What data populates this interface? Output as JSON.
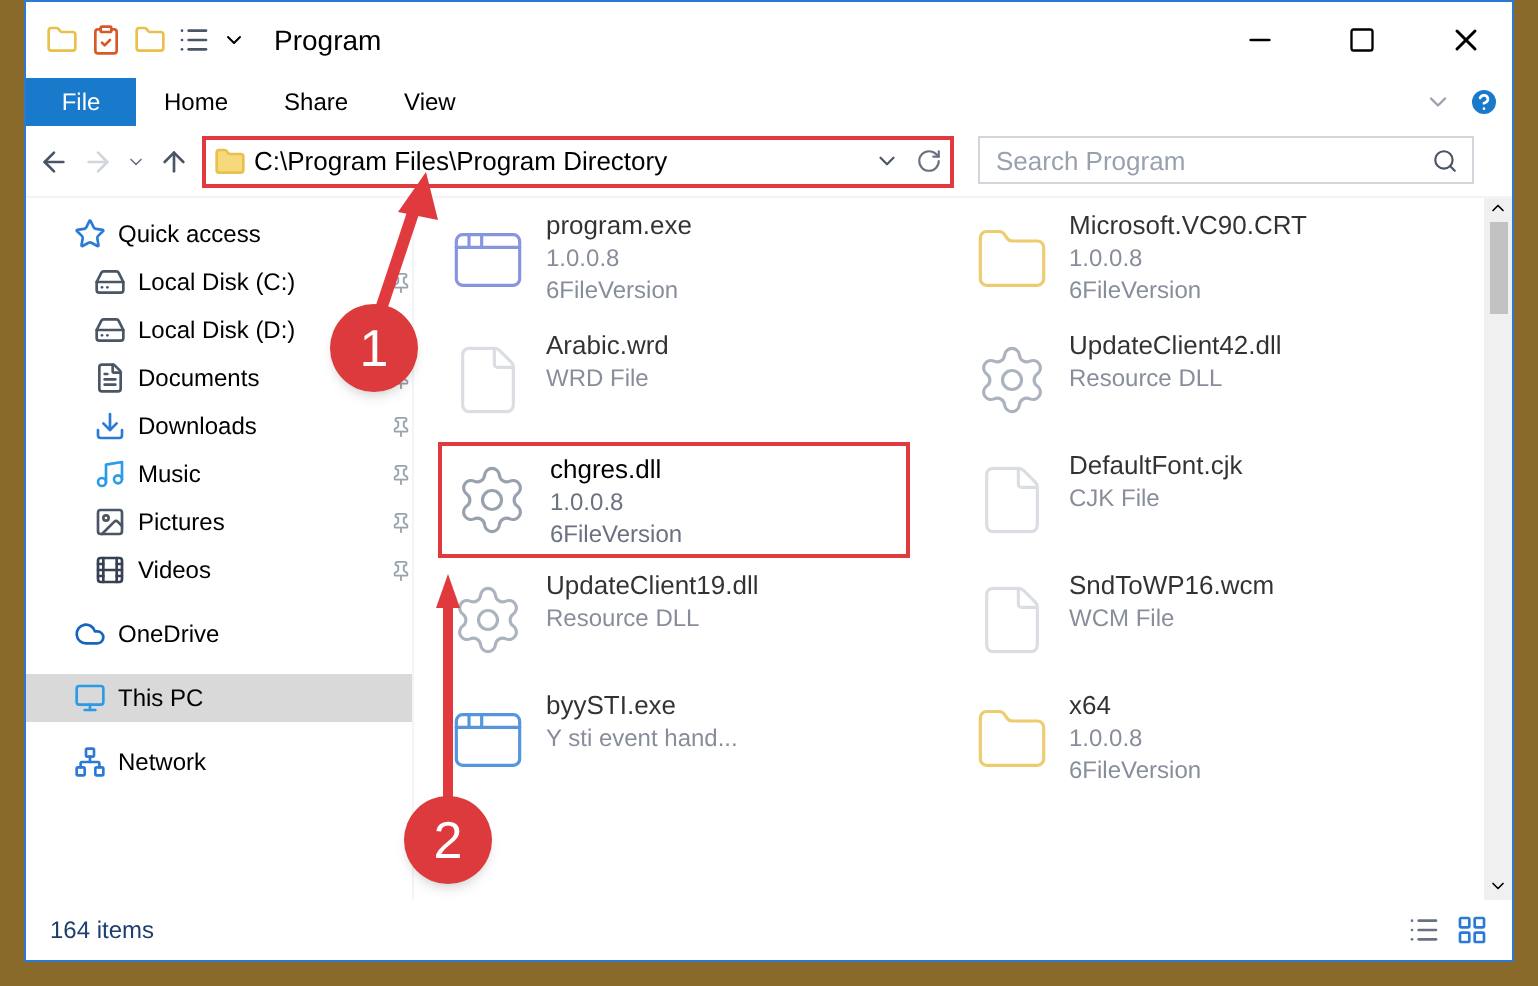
{
  "window": {
    "title": "Program"
  },
  "tabs": [
    {
      "label": "File",
      "selected": true
    },
    {
      "label": "Home",
      "selected": false
    },
    {
      "label": "Share",
      "selected": false
    },
    {
      "label": "View",
      "selected": false
    }
  ],
  "address": {
    "path": "C:\\Program Files\\Program Directory",
    "highlighted": true
  },
  "search": {
    "placeholder": "Search Program"
  },
  "nav": [
    {
      "label": "Quick access",
      "kind": "group",
      "selected": false
    },
    {
      "label": "Local Disk (C:)",
      "kind": "item",
      "selected": false
    },
    {
      "label": "Local Disk (D:)",
      "kind": "item",
      "selected": false
    },
    {
      "label": "Documents",
      "kind": "item",
      "selected": false
    },
    {
      "label": "Downloads",
      "kind": "item",
      "selected": false
    },
    {
      "label": "Music",
      "kind": "item",
      "selected": false
    },
    {
      "label": "Pictures",
      "kind": "item",
      "selected": false
    },
    {
      "label": "Videos",
      "kind": "item",
      "selected": false
    },
    {
      "label": "OneDrive",
      "kind": "group",
      "selected": false
    },
    {
      "label": "This PC",
      "kind": "group",
      "selected": true
    },
    {
      "label": "Network",
      "kind": "group",
      "selected": false
    }
  ],
  "files": [
    {
      "name": "program.exe",
      "lines": [
        "1.0.0.8",
        "6FileVersion"
      ],
      "highlighted": false
    },
    {
      "name": "Microsoft.VC90.CRT",
      "lines": [
        "1.0.0.8",
        "6FileVersion"
      ],
      "highlighted": false
    },
    {
      "name": "Arabic.wrd",
      "lines": [
        "WRD File"
      ],
      "highlighted": false
    },
    {
      "name": "UpdateClient42.dll",
      "lines": [
        "Resource DLL"
      ],
      "highlighted": false
    },
    {
      "name": "chgres.dll",
      "lines": [
        "1.0.0.8",
        "6FileVersion"
      ],
      "highlighted": true
    },
    {
      "name": "DefaultFont.cjk",
      "lines": [
        "CJK File"
      ],
      "highlighted": false
    },
    {
      "name": "UpdateClient19.dll",
      "lines": [
        "Resource DLL"
      ],
      "highlighted": false
    },
    {
      "name": "SndToWP16.wcm",
      "lines": [
        "WCM File"
      ],
      "highlighted": false
    },
    {
      "name": "byySTI.exe",
      "lines": [
        "Y sti event hand..."
      ],
      "highlighted": false
    },
    {
      "name": "x64",
      "lines": [
        "1.0.0.8",
        "6FileVersion"
      ],
      "highlighted": false
    }
  ],
  "status_bar": {
    "item_count": "164 items"
  },
  "callouts": [
    {
      "number": "1"
    },
    {
      "number": "2"
    }
  ]
}
